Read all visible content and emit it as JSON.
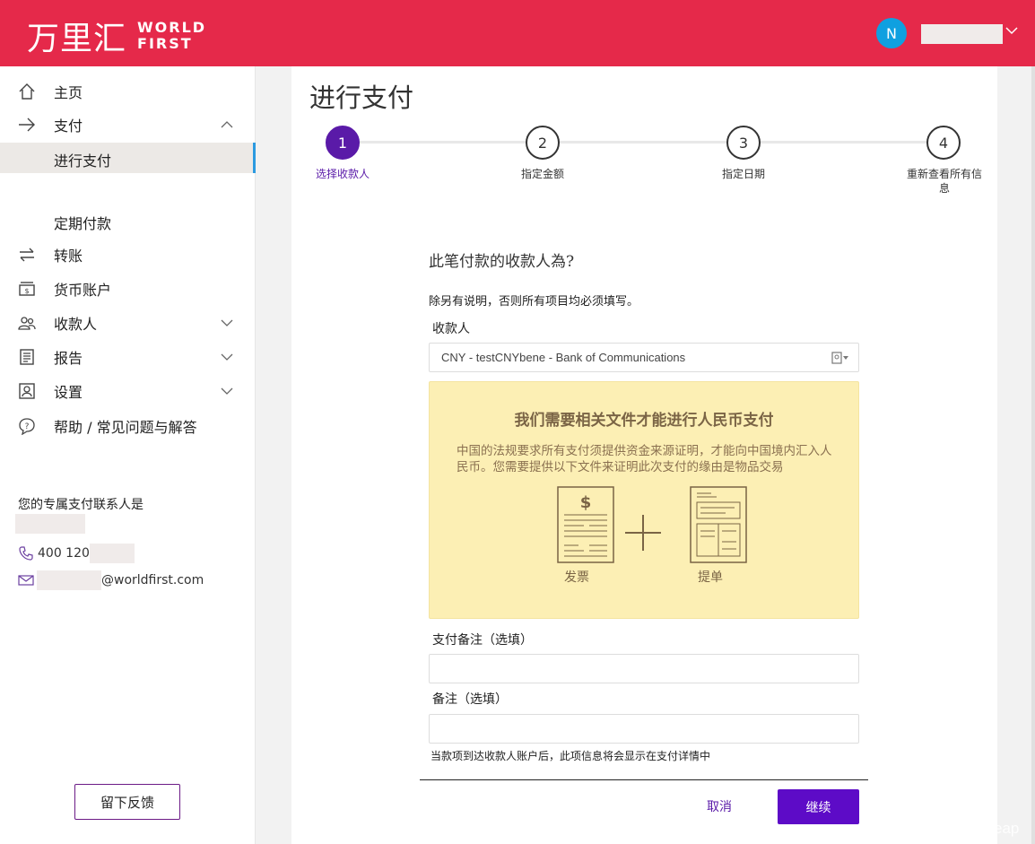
{
  "header": {
    "logo_cn": "万里汇",
    "logo_en_line1": "WORLD",
    "logo_en_line2": "FIRST",
    "avatar_initial": "N",
    "brand_color": "#e5294a"
  },
  "sidebar": {
    "items": [
      {
        "label": "主页",
        "icon": "home-icon"
      },
      {
        "label": "支付",
        "icon": "arrow-right-icon"
      },
      {
        "label": "进行支付"
      },
      {
        "label": "定期付款"
      },
      {
        "label": "转账",
        "icon": "transfer-icon"
      },
      {
        "label": "货币账户",
        "icon": "wallet-icon"
      },
      {
        "label": "收款人",
        "icon": "people-icon"
      },
      {
        "label": "报告",
        "icon": "report-icon"
      },
      {
        "label": "设置",
        "icon": "settings-icon"
      },
      {
        "label": "帮助 / 常见问题与解答",
        "icon": "help-icon"
      }
    ],
    "contact_title": "您的专属支付联系人是",
    "phone": "400 120",
    "email_domain": "@worldfirst.com",
    "feedback_label": "留下反馈"
  },
  "main": {
    "title": "进行支付",
    "steps": [
      {
        "num": "1",
        "label": "选择收款人"
      },
      {
        "num": "2",
        "label": "指定金额"
      },
      {
        "num": "3",
        "label": "指定日期"
      },
      {
        "num": "4",
        "label": "重新查看所有信息"
      }
    ],
    "question": "此笔付款的收款人為?",
    "required_note": "除另有说明，否则所有项目均必须填写。",
    "payee_label": "收款人",
    "payee_value": "CNY - testCNYbene - Bank of Communications",
    "notice": {
      "title": "我们需要相关文件才能进行人民币支付",
      "body": "中国的法规要求所有支付须提供资金来源证明，才能向中国境内汇入人民币。您需要提供以下文件来证明此次支付的缘由是物品交易",
      "invoice_label": "发票",
      "bill_label": "提单"
    },
    "payment_ref_label": "支付备注（选填）",
    "remark_label": "备注（选填）",
    "hint": "当款项到达收款人账户后，此项信息将会显示在支付详情中",
    "cancel_label": "取消",
    "continue_label": "继续",
    "accent_color": "#5a1aa8"
  },
  "watermark": "eap"
}
